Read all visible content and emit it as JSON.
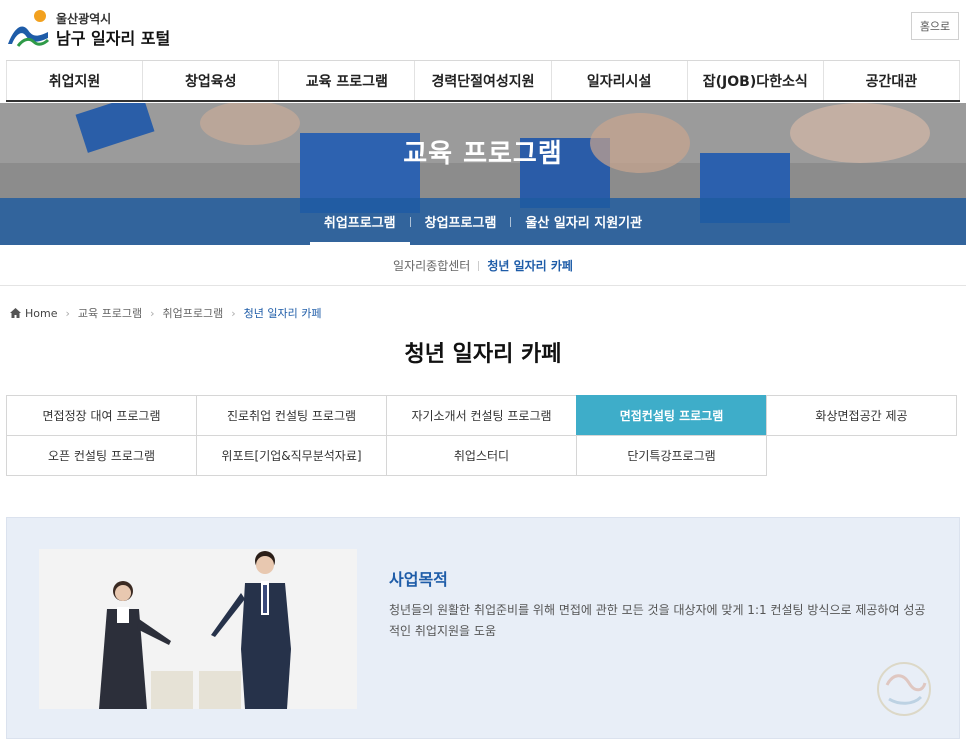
{
  "header": {
    "logo_small": "울산광역시",
    "logo_big": "남구 일자리 포털",
    "home_button": "홈으로"
  },
  "gnb": {
    "items": [
      "취업지원",
      "창업육성",
      "교육 프로그램",
      "경력단절여성지원",
      "일자리시설",
      "잡(JOB)다한소식",
      "공간대관"
    ]
  },
  "hero": {
    "title": "교육 프로그램",
    "tabs": [
      "취업프로그램",
      "창업프로그램",
      "울산 일자리 지원기관"
    ]
  },
  "third_nav": {
    "items": [
      "일자리종합센터",
      "청년 일자리 카페"
    ]
  },
  "breadcrumb": {
    "home": "Home",
    "items": [
      "교육 프로그램",
      "취업프로그램",
      "청년 일자리 카페"
    ]
  },
  "page_title": "청년 일자리 카페",
  "programs": {
    "row1": [
      "면접정장 대여 프로그램",
      "진로취업 컨설팅 프로그램",
      "자기소개서 컨설팅 프로그램",
      "면접컨설팅 프로그램",
      "화상면접공간 제공"
    ],
    "row2": [
      "오픈 컨설팅 프로그램",
      "위포트[기업&직무분석자료]",
      "취업스터디",
      "단기특강프로그램"
    ]
  },
  "content": {
    "title": "사업목적",
    "description": "청년들의 원활한 취업준비를 위해 면접에 관한 모든 것을 대상자에 맞게 1:1 컨설팅 방식으로 제공하여 성공적인 취업지원을 도움"
  },
  "colors": {
    "accent_blue": "#1e5ca8",
    "active_tab": "#3eadc9",
    "content_bg": "#e8eef7"
  }
}
